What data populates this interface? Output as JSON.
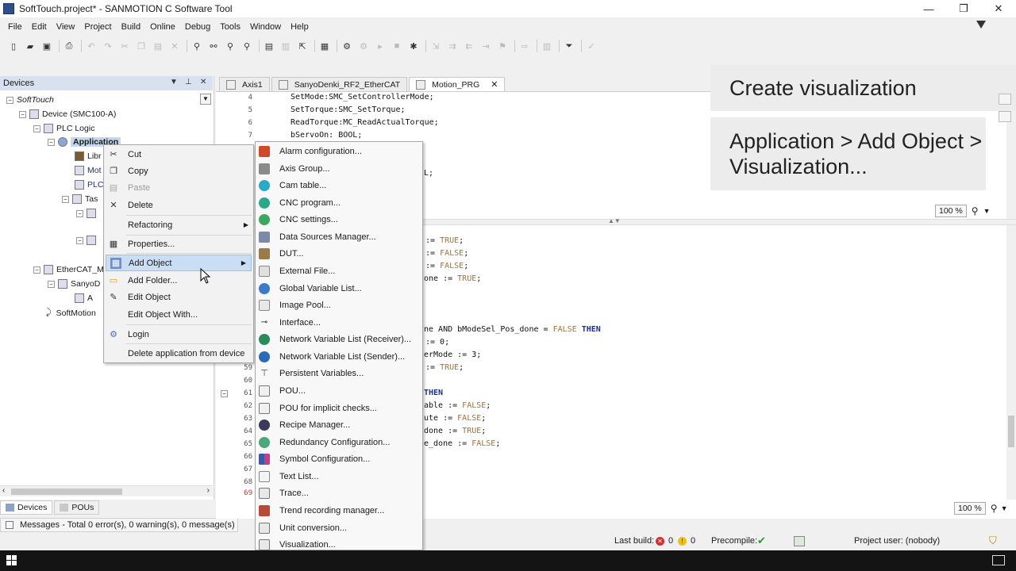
{
  "window": {
    "title": "SoftTouch.project* - SANMOTION C Software Tool",
    "minimize": "—",
    "restore": "❐",
    "close": "✕"
  },
  "menu": [
    "File",
    "Edit",
    "View",
    "Project",
    "Build",
    "Online",
    "Debug",
    "Tools",
    "Window",
    "Help"
  ],
  "devices_panel": {
    "title": "Devices",
    "tree": {
      "root": "SoftTouch",
      "device": "Device (SMC100-A)",
      "plc_logic": "PLC Logic",
      "application": "Application",
      "lib": "Libr",
      "mot": "Mot",
      "plc": "PLC",
      "tas": "Tas",
      "ethercat": "EtherCAT_M",
      "sanyo": "SanyoD",
      "axis_a": "A",
      "softmotion": "SoftMotion"
    },
    "bottom_tabs": [
      "Devices",
      "POUs"
    ]
  },
  "messages": "Messages - Total 0 error(s), 0 warning(s), 0 message(s)",
  "editor": {
    "tabs": [
      "Axis1",
      "SanyoDenki_RF2_EtherCAT",
      "Motion_PRG"
    ],
    "top_lines": [
      {
        "n": "4",
        "code": "SetMode:SMC_SetControllerMode;"
      },
      {
        "n": "5",
        "code": "SetTorque:SMC_SetTorque;"
      },
      {
        "n": "6",
        "code": "ReadTorque:MC_ReadActualTorque;"
      },
      {
        "n": "7",
        "code": "bServoOn: BOOL;"
      }
    ],
    "top_fragment": "L;",
    "zoom_top": "100 %",
    "zoom_bottom": "100 %",
    "bottom_fragments": [
      {
        "pre": ":= ",
        "val": "TRUE",
        "post": ";"
      },
      {
        "pre": " := ",
        "val": "FALSE",
        "post": ";"
      },
      {
        "pre": " := ",
        "val": "FALSE",
        "post": ";"
      },
      {
        "pre": "one := ",
        "val": "TRUE",
        "post": ";"
      }
    ],
    "if_line": {
      "a": "ne AND bModeSel_Pos_done = ",
      "val": "FALSE",
      "kw": " THEN"
    },
    "mid_lines": [
      ":= 0;",
      "erMode := 3;"
    ],
    "mid_true": {
      "pre": ":= ",
      "val": "TRUE",
      "post": ";"
    },
    "then_kw": "THEN",
    "end_lines": [
      {
        "pre": "able := ",
        "val": "FALSE",
        "post": ";"
      },
      {
        "pre": "ute := ",
        "val": "FALSE",
        "post": ";"
      },
      {
        "pre": "done := ",
        "val": "TRUE",
        "post": ";"
      },
      {
        "pre": "e_done := ",
        "val": "FALSE",
        "post": ";"
      }
    ],
    "bottom_numbers": [
      "59",
      "60",
      "61",
      "62",
      "63",
      "64",
      "65",
      "66",
      "67",
      "68",
      "69"
    ]
  },
  "overlay": {
    "step": "Create visualization",
    "path": "Application > Add Object > Visualization..."
  },
  "context_menu": [
    {
      "label": "Cut",
      "icon": "✂"
    },
    {
      "label": "Copy",
      "icon": "❐"
    },
    {
      "label": "Paste",
      "icon": "▤"
    },
    {
      "label": "Delete",
      "icon": "✕"
    },
    {
      "label": "Refactoring",
      "icon": ""
    },
    {
      "label": "Properties...",
      "icon": "▦"
    },
    {
      "label": "Add Object",
      "icon": "▦"
    },
    {
      "label": "Add Folder...",
      "icon": "▭"
    },
    {
      "label": "Edit Object",
      "icon": "✎"
    },
    {
      "label": "Edit Object With...",
      "icon": ""
    },
    {
      "label": "Login",
      "icon": "⚙"
    },
    {
      "label": "Delete application from device",
      "icon": ""
    }
  ],
  "submenu": [
    "Alarm configuration...",
    "Axis Group...",
    "Cam table...",
    "CNC program...",
    "CNC settings...",
    "Data Sources Manager...",
    "DUT...",
    "External File...",
    "Global Variable List...",
    "Image Pool...",
    "Interface...",
    "Network Variable List (Receiver)...",
    "Network Variable List (Sender)...",
    "Persistent Variables...",
    "POU...",
    "POU for implicit checks...",
    "Recipe Manager...",
    "Redundancy Configuration...",
    "Symbol Configuration...",
    "Text List...",
    "Trace...",
    "Trend recording manager...",
    "Unit conversion...",
    "Visualization..."
  ],
  "status_bar": {
    "last_build": "Last build:",
    "errors": "0",
    "warnings": "0",
    "precompile": "Precompile:",
    "project_user": "Project user: (nobody)"
  },
  "colors": {
    "accent": "#c9def5",
    "selection": "#c5d6ef",
    "keyword": "#1a2f9a",
    "value": "#b07020"
  }
}
